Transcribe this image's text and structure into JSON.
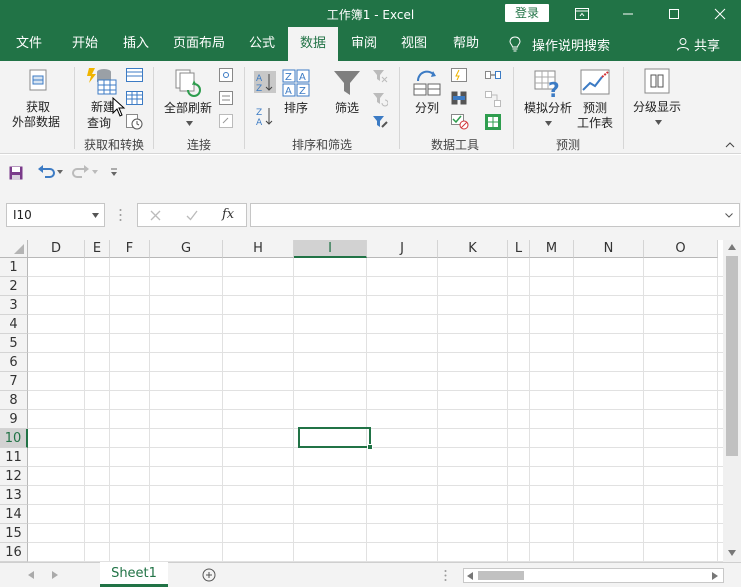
{
  "window": {
    "title": "工作簿1 - Excel",
    "login_label": "登录",
    "accent": "#217346"
  },
  "tabs": [
    {
      "label": "文件"
    },
    {
      "label": "开始"
    },
    {
      "label": "插入"
    },
    {
      "label": "页面布局"
    },
    {
      "label": "公式"
    },
    {
      "label": "数据",
      "active": true
    },
    {
      "label": "审阅"
    },
    {
      "label": "视图"
    },
    {
      "label": "帮助"
    }
  ],
  "tell_me": "操作说明搜索",
  "share_label": "共享",
  "ribbon": {
    "get_external_1": "获取",
    "get_external_2": "外部数据",
    "new_query_1": "新建",
    "new_query_2": "查询",
    "group_get_transform": "获取和转换",
    "refresh_all": "全部刷新",
    "group_connections": "连接",
    "sort": "排序",
    "filter": "筛选",
    "group_sort_filter": "排序和筛选",
    "text_to_columns": "分列",
    "group_data_tools": "数据工具",
    "what_if_1": "模拟分析",
    "forecast_sheet_1": "预测",
    "forecast_sheet_2": "工作表",
    "group_forecast": "预测",
    "outline": "分级显示"
  },
  "name_box": "I10",
  "fx_label": "fx",
  "columns": [
    "D",
    "E",
    "F",
    "G",
    "H",
    "I",
    "J",
    "K",
    "L",
    "M",
    "N",
    "O"
  ],
  "selected_column": "I",
  "rows": [
    "1",
    "2",
    "3",
    "4",
    "5",
    "6",
    "7",
    "8",
    "9",
    "10",
    "11",
    "12",
    "13",
    "14",
    "15",
    "16"
  ],
  "selected_row": "10",
  "sheet_tab": "Sheet1"
}
